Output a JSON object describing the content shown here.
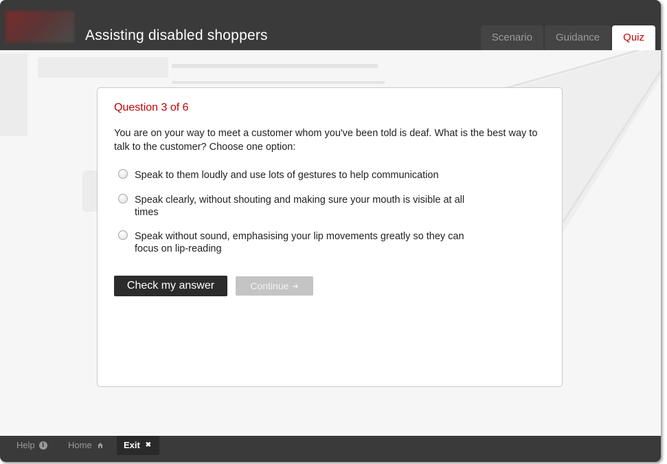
{
  "header": {
    "title": "Assisting disabled shoppers",
    "tabs": [
      {
        "label": "Scenario",
        "active": false
      },
      {
        "label": "Guidance",
        "active": false
      },
      {
        "label": "Quiz",
        "active": true
      }
    ]
  },
  "quiz": {
    "question_number": "Question 3 of 6",
    "question_text": "You are on your way to meet a customer whom you've been told is deaf. What is the best way to talk to the customer? Choose one option:",
    "options": [
      {
        "label": "Speak to them loudly and use lots of gestures to help communication",
        "selected": false
      },
      {
        "label": "Speak clearly, without shouting and making sure your mouth is visible at all times",
        "selected": false
      },
      {
        "label": "Speak without sound, emphasising your lip movements greatly so they can focus on lip-reading",
        "selected": false
      }
    ],
    "check_button": "Check my answer",
    "continue_button": "Continue",
    "continue_enabled": false
  },
  "footer": {
    "help_label": "Help",
    "home_label": "Home",
    "exit_label": "Exit"
  },
  "colors": {
    "accent": "#c00000",
    "chrome": "#3a3a3a",
    "button_dark": "#2c2c2c",
    "button_disabled": "#c4c4c4"
  },
  "icons": {
    "help": "info-icon",
    "home": "home-icon",
    "exit": "close-icon",
    "continue": "arrow-right-icon"
  }
}
